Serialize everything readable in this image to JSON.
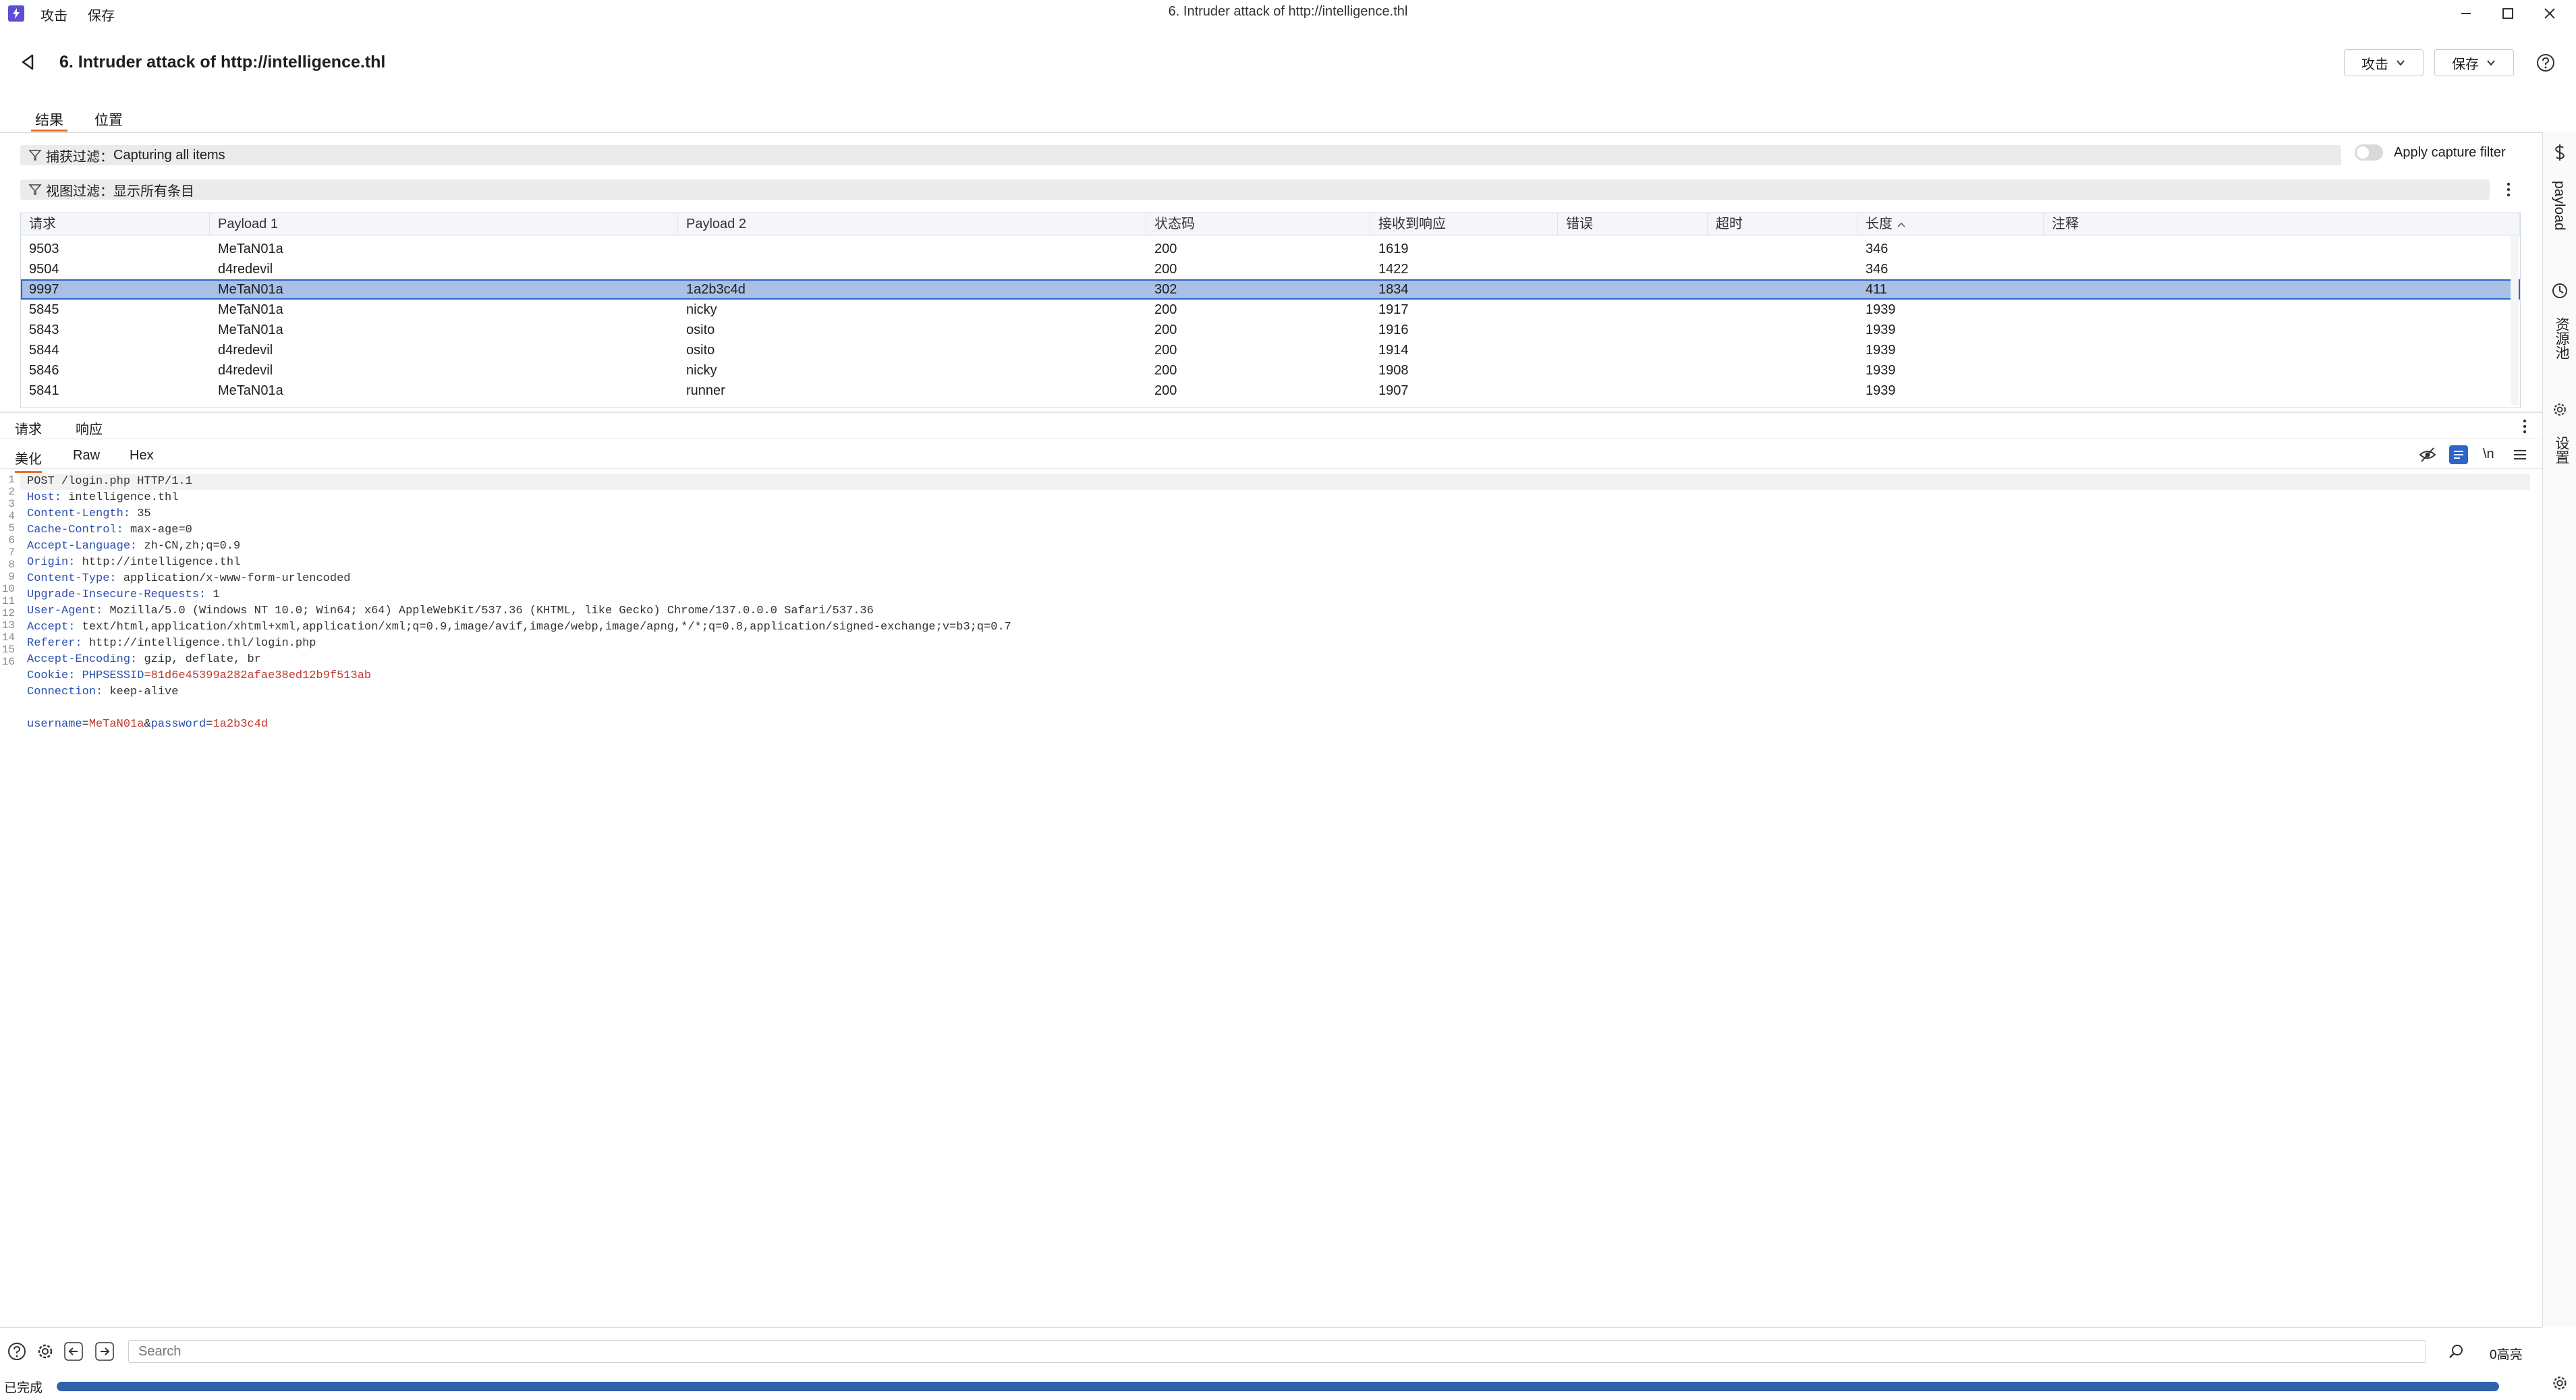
{
  "titlebar": {
    "menu": [
      "攻击",
      "保存"
    ],
    "title": "6. Intruder attack of http://intelligence.thl"
  },
  "header": {
    "title": "6. Intruder attack of http://intelligence.thl",
    "attack_label": "攻击",
    "save_label": "保存"
  },
  "tabs": [
    "结果",
    "位置"
  ],
  "capture_filter": {
    "label": "捕获过滤：",
    "value": "Capturing all items",
    "toggle_label": "Apply capture filter",
    "toggle_on": false
  },
  "view_filter": {
    "label": "视图过滤：",
    "value": "显示所有条目"
  },
  "table": {
    "columns": [
      "请求",
      "Payload 1",
      "Payload 2",
      "状态码",
      "接收到响应",
      "错误",
      "超时",
      "长度",
      "注释"
    ],
    "sort_column": "长度",
    "rows": [
      {
        "req": "9503",
        "p1": "MeTaN01a",
        "p2": "",
        "status": "200",
        "resp": "1619",
        "len": "346"
      },
      {
        "req": "9504",
        "p1": "d4redevil",
        "p2": "",
        "status": "200",
        "resp": "1422",
        "len": "346"
      },
      {
        "req": "9997",
        "p1": "MeTaN01a",
        "p2": "1a2b3c4d",
        "status": "302",
        "resp": "1834",
        "len": "411",
        "selected": true
      },
      {
        "req": "5845",
        "p1": "MeTaN01a",
        "p2": "nicky",
        "status": "200",
        "resp": "1917",
        "len": "1939"
      },
      {
        "req": "5843",
        "p1": "MeTaN01a",
        "p2": "osito",
        "status": "200",
        "resp": "1916",
        "len": "1939"
      },
      {
        "req": "5844",
        "p1": "d4redevil",
        "p2": "osito",
        "status": "200",
        "resp": "1914",
        "len": "1939"
      },
      {
        "req": "5846",
        "p1": "d4redevil",
        "p2": "nicky",
        "status": "200",
        "resp": "1908",
        "len": "1939"
      },
      {
        "req": "5841",
        "p1": "MeTaN01a",
        "p2": "runner",
        "status": "200",
        "resp": "1907",
        "len": "1939"
      }
    ]
  },
  "detail": {
    "tabs": [
      "请求",
      "响应"
    ],
    "view_tabs": [
      "美化",
      "Raw",
      "Hex"
    ],
    "newline_toggle": "\\n",
    "request_line": "POST /login.php HTTP/1.1",
    "headers": [
      {
        "name": "Host",
        "value": "intelligence.thl"
      },
      {
        "name": "Content-Length",
        "value": "35"
      },
      {
        "name": "Cache-Control",
        "value": "max-age=0"
      },
      {
        "name": "Accept-Language",
        "value": "zh-CN,zh;q=0.9"
      },
      {
        "name": "Origin",
        "value": "http://intelligence.thl"
      },
      {
        "name": "Content-Type",
        "value": "application/x-www-form-urlencoded"
      },
      {
        "name": "Upgrade-Insecure-Requests",
        "value": "1"
      },
      {
        "name": "User-Agent",
        "value": "Mozilla/5.0 (Windows NT 10.0; Win64; x64) AppleWebKit/537.36 (KHTML, like Gecko) Chrome/137.0.0.0 Safari/537.36"
      },
      {
        "name": "Accept",
        "value": "text/html,application/xhtml+xml,application/xml;q=0.9,image/avif,image/webp,image/apng,*/*;q=0.8,application/signed-exchange;v=b3;q=0.7"
      },
      {
        "name": "Referer",
        "value": "http://intelligence.thl/login.php"
      },
      {
        "name": "Accept-Encoding",
        "value": "gzip, deflate, br"
      },
      {
        "name": "Cookie",
        "value": ""
      },
      {
        "name": "Connection",
        "value": "keep-alive"
      }
    ],
    "cookie_name": "PHPSESSID",
    "cookie_value": "81d6e45399a282afae38ed12b9f513ab",
    "body": {
      "k1": "username",
      "v1": "MeTaN01a",
      "k2": "password",
      "v2": "1a2b3c4d"
    },
    "line_numbers": [
      "1",
      "2",
      "3",
      "4",
      "5",
      "6",
      "7",
      "8",
      "9",
      "10",
      "11",
      "12",
      "13",
      "14",
      "15",
      "16"
    ]
  },
  "search": {
    "placeholder": "Search",
    "highlights": "0高亮"
  },
  "status": {
    "label": "已完成",
    "progress": 1.0
  },
  "sidebar": [
    "payload",
    "资源池",
    "设置"
  ]
}
